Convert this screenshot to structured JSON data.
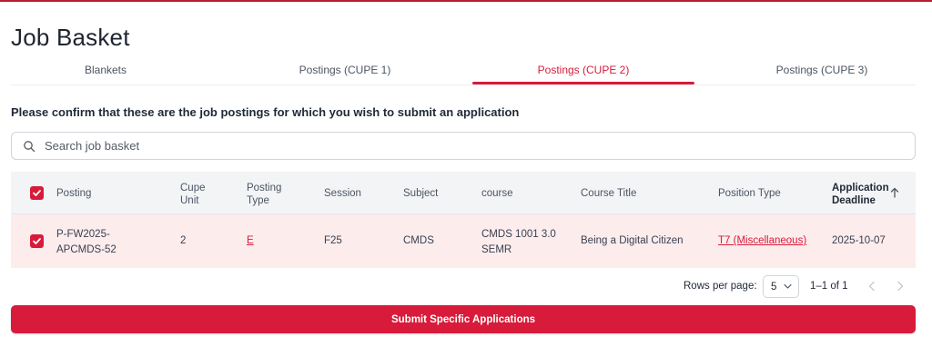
{
  "colors": {
    "accent": "#d81b3a",
    "row_selected_bg": "#fdecec",
    "header_bg": "#f3f4f6"
  },
  "page": {
    "title": "Job Basket"
  },
  "tabs": [
    {
      "label": "Blankets",
      "active": false
    },
    {
      "label": "Postings (CUPE 1)",
      "active": false
    },
    {
      "label": "Postings (CUPE 2)",
      "active": true
    },
    {
      "label": "Postings (CUPE 3)",
      "active": false
    }
  ],
  "instruction": "Please confirm that these are the job postings for which you wish to submit an application",
  "search": {
    "placeholder": "Search job basket",
    "value": "",
    "icon": "search-icon"
  },
  "table": {
    "select_all_checked": true,
    "columns": {
      "posting": "Posting",
      "cupe_unit_1": "Cupe",
      "cupe_unit_2": "Unit",
      "posting_type_1": "Posting",
      "posting_type_2": "Type",
      "session": "Session",
      "subject": "Subject",
      "course": "course",
      "course_title": "Course Title",
      "position_type": "Position Type",
      "deadline_1": "Application",
      "deadline_2": "Deadline"
    },
    "sort": {
      "column": "Application Deadline",
      "direction": "ascending",
      "icon": "arrow-up-icon"
    },
    "rows": [
      {
        "checked": true,
        "posting_1": "P-FW2025-",
        "posting_2": "APCMDS-52",
        "cupe_unit": "2",
        "posting_type": "E",
        "session": "F25",
        "subject": "CMDS",
        "course_1": "CMDS 1001 3.0",
        "course_2": "SEMR",
        "course_title": "Being a Digital Citizen",
        "position_type": "T7 (Miscellaneous)",
        "deadline": "2025-10-07"
      }
    ]
  },
  "pagination": {
    "rows_per_page_label": "Rows per page:",
    "rows_per_page": "5",
    "range": "1–1 of 1",
    "prev_icon": "chevron-left-icon",
    "next_icon": "chevron-right-icon"
  },
  "actions": {
    "submit_label": "Submit Specific Applications"
  }
}
